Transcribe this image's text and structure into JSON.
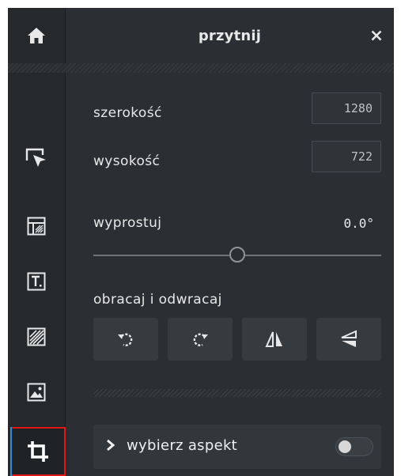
{
  "header": {
    "title": "przytnij"
  },
  "fields": {
    "width_label": "szerokość",
    "width_value": "1280",
    "height_label": "wysokość",
    "height_value": "722"
  },
  "straighten": {
    "label": "wyprostuj",
    "value": "0.0°",
    "slider_position": 0.5
  },
  "rotate": {
    "label": "obracaj i odwracaj"
  },
  "aspect": {
    "label": "wybierz aspekt",
    "toggle_on": false
  },
  "toolbar": {
    "items": [
      "home-icon",
      "select-cursor-icon",
      "layout-icon",
      "text-icon",
      "texture-icon",
      "image-icon",
      "crop-icon"
    ],
    "active": "crop-icon"
  },
  "colors": {
    "panel": "#2b2f33",
    "toolbar": "#25292c",
    "active_outline": "#e01818",
    "active_bar": "#2d8fd5"
  }
}
